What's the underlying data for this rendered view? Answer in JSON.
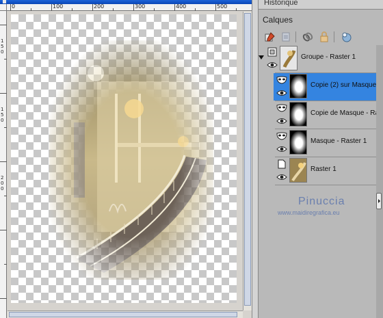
{
  "canvas": {
    "ruler_labels": [
      "0",
      "100",
      "200",
      "300",
      "400",
      "500"
    ],
    "vertical_ruler_labels": [
      "1",
      "5",
      "0",
      "1",
      "5",
      "0",
      "2",
      "0",
      "0"
    ]
  },
  "panel": {
    "historique_label": "Historique",
    "title": "Calques",
    "toolbar_icons": [
      "new-raster-layer-icon",
      "layer-properties-icon",
      "link-icon",
      "lock-icon",
      "mask-icon"
    ],
    "layers": [
      {
        "name": "Groupe - Raster 1",
        "type": "group",
        "selected": false
      },
      {
        "name": "Copie (2) sur Masque -",
        "type": "mask",
        "selected": true
      },
      {
        "name": "Copie de Masque - Ra",
        "type": "mask",
        "selected": false
      },
      {
        "name": "Masque - Raster 1",
        "type": "mask",
        "selected": false
      },
      {
        "name": "Raster 1",
        "type": "raster",
        "selected": false
      }
    ]
  },
  "watermark": {
    "name": "Pinuccia",
    "url": "www.maidiregrafica.eu"
  },
  "colors": {
    "selection": "#3484e0",
    "panel_bg": "#b9b9b9",
    "watermark": "#6a7fae"
  }
}
